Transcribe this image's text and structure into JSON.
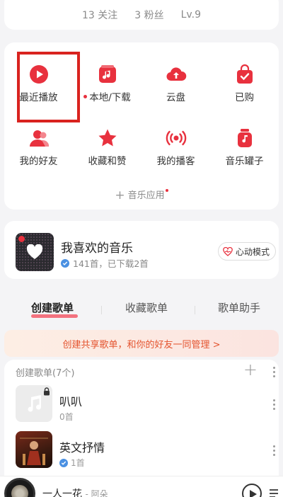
{
  "stats": {
    "following": "13 关注",
    "followers": "3 粉丝",
    "level": "Lv.9"
  },
  "grid": {
    "items": [
      {
        "label": "最近播放",
        "icon": "play-circle-icon"
      },
      {
        "label": "本地/下载",
        "icon": "local-music-icon"
      },
      {
        "label": "云盘",
        "icon": "cloud-upload-icon"
      },
      {
        "label": "已购",
        "icon": "purchased-bag-icon"
      },
      {
        "label": "我的好友",
        "icon": "friends-icon"
      },
      {
        "label": "收藏和赞",
        "icon": "star-icon"
      },
      {
        "label": "我的播客",
        "icon": "podcast-icon"
      },
      {
        "label": "音乐罐子",
        "icon": "music-jar-icon"
      }
    ],
    "apps_label": "音乐应用"
  },
  "favorite": {
    "title": "我喜欢的音乐",
    "subtitle": "141首，已下载2首",
    "heartbeat_label": "心动模式"
  },
  "tabs": {
    "created": "创建歌单",
    "collected": "收藏歌单",
    "assistant": "歌单助手"
  },
  "banner": {
    "text": "创建共享歌单，和你的好友一同管理 >"
  },
  "playlists": {
    "header": "创建歌单(7个)",
    "items": [
      {
        "title": "叭叭",
        "count": "0首"
      },
      {
        "title": "英文抒情",
        "count": "1首"
      }
    ]
  },
  "player": {
    "song": "一人一花",
    "artist": "- 阿朵"
  },
  "colors": {
    "accent": "#e8313e",
    "banner_text": "#e4542f",
    "highlight": "#d9231f"
  }
}
